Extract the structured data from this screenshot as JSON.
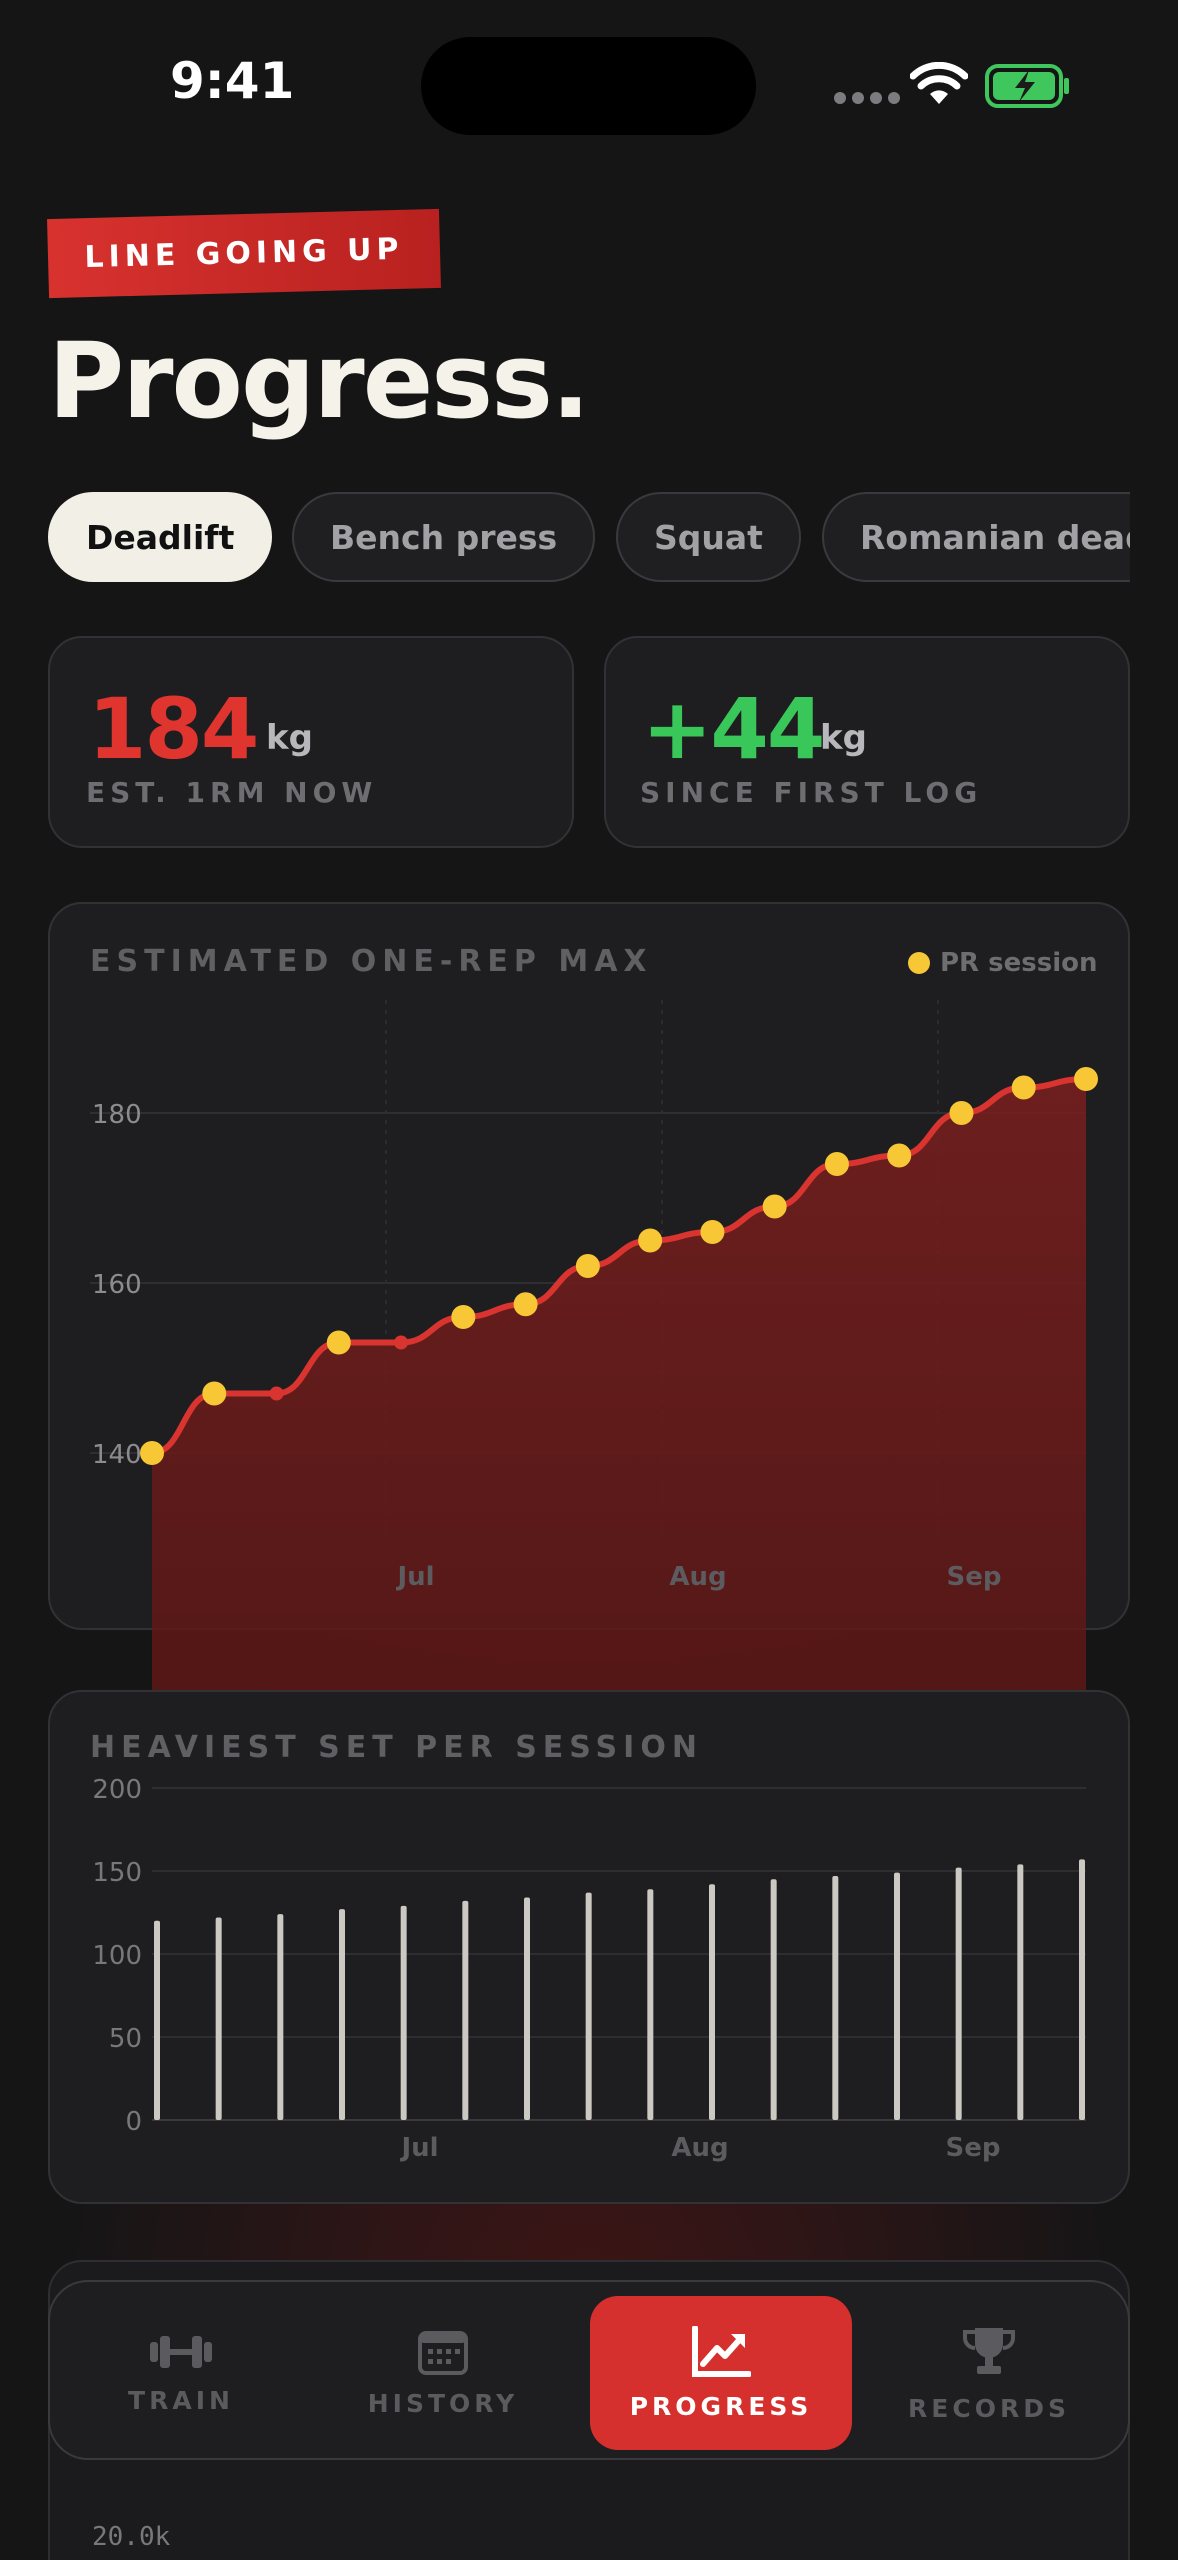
{
  "status_bar": {
    "time": "9:41"
  },
  "header": {
    "badge": "LINE GOING UP",
    "title": "Progress."
  },
  "exercise_pills": [
    {
      "label": "Deadlift",
      "active": true
    },
    {
      "label": "Bench press",
      "active": false
    },
    {
      "label": "Squat",
      "active": false
    },
    {
      "label": "Romanian dead",
      "active": false
    }
  ],
  "stats": {
    "est_1rm": {
      "value": "184",
      "unit": "kg",
      "label": "EST. 1RM NOW",
      "color": "#e0352f"
    },
    "since_first": {
      "value": "+44",
      "unit": "kg",
      "label": "SINCE FIRST LOG",
      "color": "#39c75a"
    }
  },
  "chart_data": [
    {
      "type": "line",
      "title": "ESTIMATED ONE-REP MAX",
      "legend": "PR session",
      "x_tick_labels": [
        "Jul",
        "Aug",
        "Sep"
      ],
      "y_ticks": [
        140,
        160,
        180
      ],
      "ylim": [
        127,
        192
      ],
      "values": [
        140,
        147,
        147,
        153,
        153,
        156,
        157.5,
        162,
        165,
        166,
        169,
        174,
        175,
        180,
        183,
        184
      ],
      "pr_session": [
        true,
        true,
        false,
        true,
        false,
        true,
        true,
        true,
        true,
        true,
        true,
        true,
        true,
        true,
        true,
        true
      ],
      "colors": {
        "line": "#d9342f",
        "pr": "#f7c736",
        "area": "#7a1f1d"
      }
    },
    {
      "type": "bar",
      "title": "HEAVIEST SET PER SESSION",
      "x_tick_labels": [
        "Jul",
        "Aug",
        "Sep"
      ],
      "y_ticks": [
        0,
        50,
        100,
        150,
        200
      ],
      "ylim": [
        0,
        200
      ],
      "values": [
        120,
        122,
        124,
        127,
        129,
        132,
        134,
        137,
        139,
        142,
        145,
        147,
        149,
        152,
        154,
        157
      ],
      "colors": {
        "bar": "#cbc9c2"
      }
    }
  ],
  "partial_chart": {
    "first_tick": "20.0k"
  },
  "nav": [
    {
      "label": "TRAIN",
      "icon": "dumbbell-icon",
      "active": false
    },
    {
      "label": "HISTORY",
      "icon": "calendar-icon",
      "active": false
    },
    {
      "label": "PROGRESS",
      "icon": "chart-up-icon",
      "active": true
    },
    {
      "label": "RECORDS",
      "icon": "trophy-icon",
      "active": false
    }
  ]
}
